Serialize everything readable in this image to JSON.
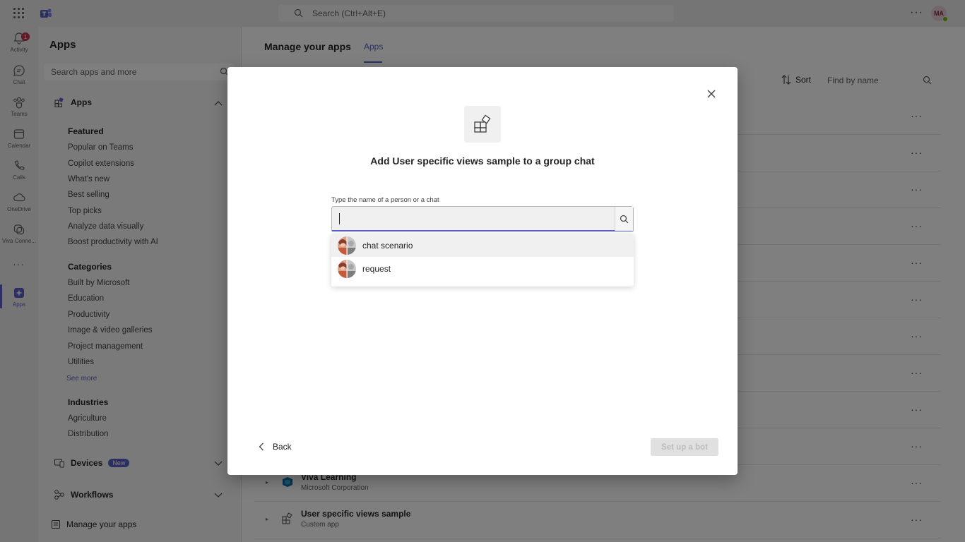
{
  "topbar": {
    "search_placeholder": "Search (Ctrl+Alt+E)",
    "more": "···",
    "avatar_initials": "MA",
    "status_color": "#6bb700"
  },
  "rail": {
    "items": [
      {
        "label": "Activity",
        "icon": "bell-icon",
        "badge": "1"
      },
      {
        "label": "Chat",
        "icon": "chat-icon"
      },
      {
        "label": "Teams",
        "icon": "teams-icon"
      },
      {
        "label": "Calendar",
        "icon": "calendar-icon"
      },
      {
        "label": "Calls",
        "icon": "phone-icon"
      },
      {
        "label": "OneDrive",
        "icon": "cloud-icon"
      },
      {
        "label": "Viva Conne...",
        "icon": "viva-icon"
      },
      {
        "label": "Apps",
        "icon": "apps-add-icon",
        "active": true
      }
    ],
    "more": "···"
  },
  "left_panel": {
    "title": "Apps",
    "search_placeholder": "Search apps and more",
    "apps_section": "Apps",
    "featured": {
      "title": "Featured",
      "items": [
        "Popular on Teams",
        "Copilot extensions",
        "What's new",
        "Best selling",
        "Top picks",
        "Analyze data visually",
        "Boost productivity with AI"
      ]
    },
    "categories": {
      "title": "Categories",
      "items": [
        "Built by Microsoft",
        "Education",
        "Productivity",
        "Image & video galleries",
        "Project management",
        "Utilities"
      ],
      "see_more": "See more"
    },
    "industries": {
      "title": "Industries",
      "items": [
        "Agriculture",
        "Distribution"
      ]
    },
    "devices": {
      "label": "Devices",
      "badge": "New"
    },
    "workflows": {
      "label": "Workflows"
    },
    "manage_apps": "Manage your apps"
  },
  "main": {
    "title": "Manage your apps",
    "tab": "Apps",
    "sort": "Sort",
    "find_placeholder": "Find by name",
    "rows": [
      {
        "name": "",
        "sub": ""
      },
      {
        "name": "",
        "sub": ""
      },
      {
        "name": "",
        "sub": ""
      },
      {
        "name": "",
        "sub": ""
      },
      {
        "name": "",
        "sub": ""
      },
      {
        "name": "",
        "sub": ""
      },
      {
        "name": "",
        "sub": ""
      },
      {
        "name": "",
        "sub": ""
      },
      {
        "name": "",
        "sub": ""
      },
      {
        "name": "",
        "sub": ""
      },
      {
        "name": "Viva Learning",
        "sub": "Microsoft Corporation"
      },
      {
        "name": "User specific views sample",
        "sub": "Custom app"
      }
    ],
    "row_more": "···"
  },
  "dialog": {
    "title": "Add User specific views sample to a group chat",
    "field_label": "Type the name of a person or a chat",
    "input_value": "",
    "suggestions": [
      {
        "label": "chat scenario"
      },
      {
        "label": "request"
      }
    ],
    "back": "Back",
    "primary": "Set up a bot"
  },
  "colors": {
    "accent": "#5b5fc7",
    "badge": "#c4314b"
  }
}
